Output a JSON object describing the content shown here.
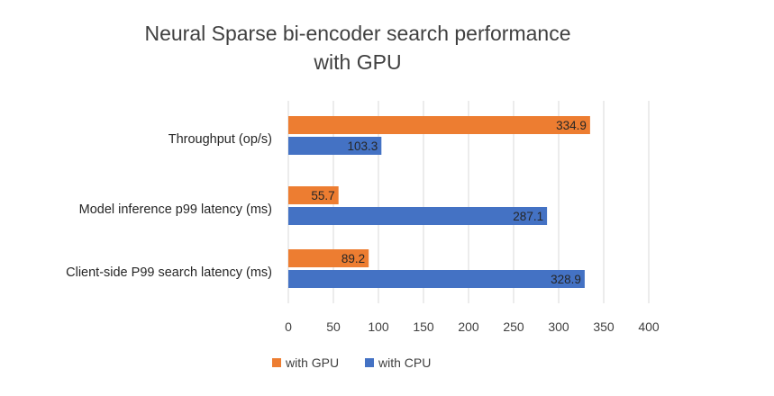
{
  "chart_data": {
    "type": "bar",
    "orientation": "horizontal",
    "title": "Neural Sparse bi-encoder search performance with GPU",
    "title_lines": [
      "Neural Sparse bi-encoder search performance",
      "with GPU"
    ],
    "categories": [
      "Throughput (op/s)",
      "Model inference p99 latency (ms)",
      "Client-side P99 search latency (ms)"
    ],
    "series": [
      {
        "name": "with GPU",
        "color": "#ed7d31",
        "values": [
          334.9,
          55.7,
          89.2
        ],
        "labels": [
          "334.9",
          "55.7",
          "89.2"
        ]
      },
      {
        "name": "with CPU",
        "color": "#4472c4",
        "values": [
          103.3,
          287.1,
          328.9
        ],
        "labels": [
          "103.3",
          "287.1",
          "328.9"
        ]
      }
    ],
    "xlim": [
      0,
      400
    ],
    "xticks": [
      "0",
      "50",
      "100",
      "150",
      "200",
      "250",
      "300",
      "350",
      "400"
    ],
    "grid": "vertical",
    "legend_position": "bottom-left"
  }
}
